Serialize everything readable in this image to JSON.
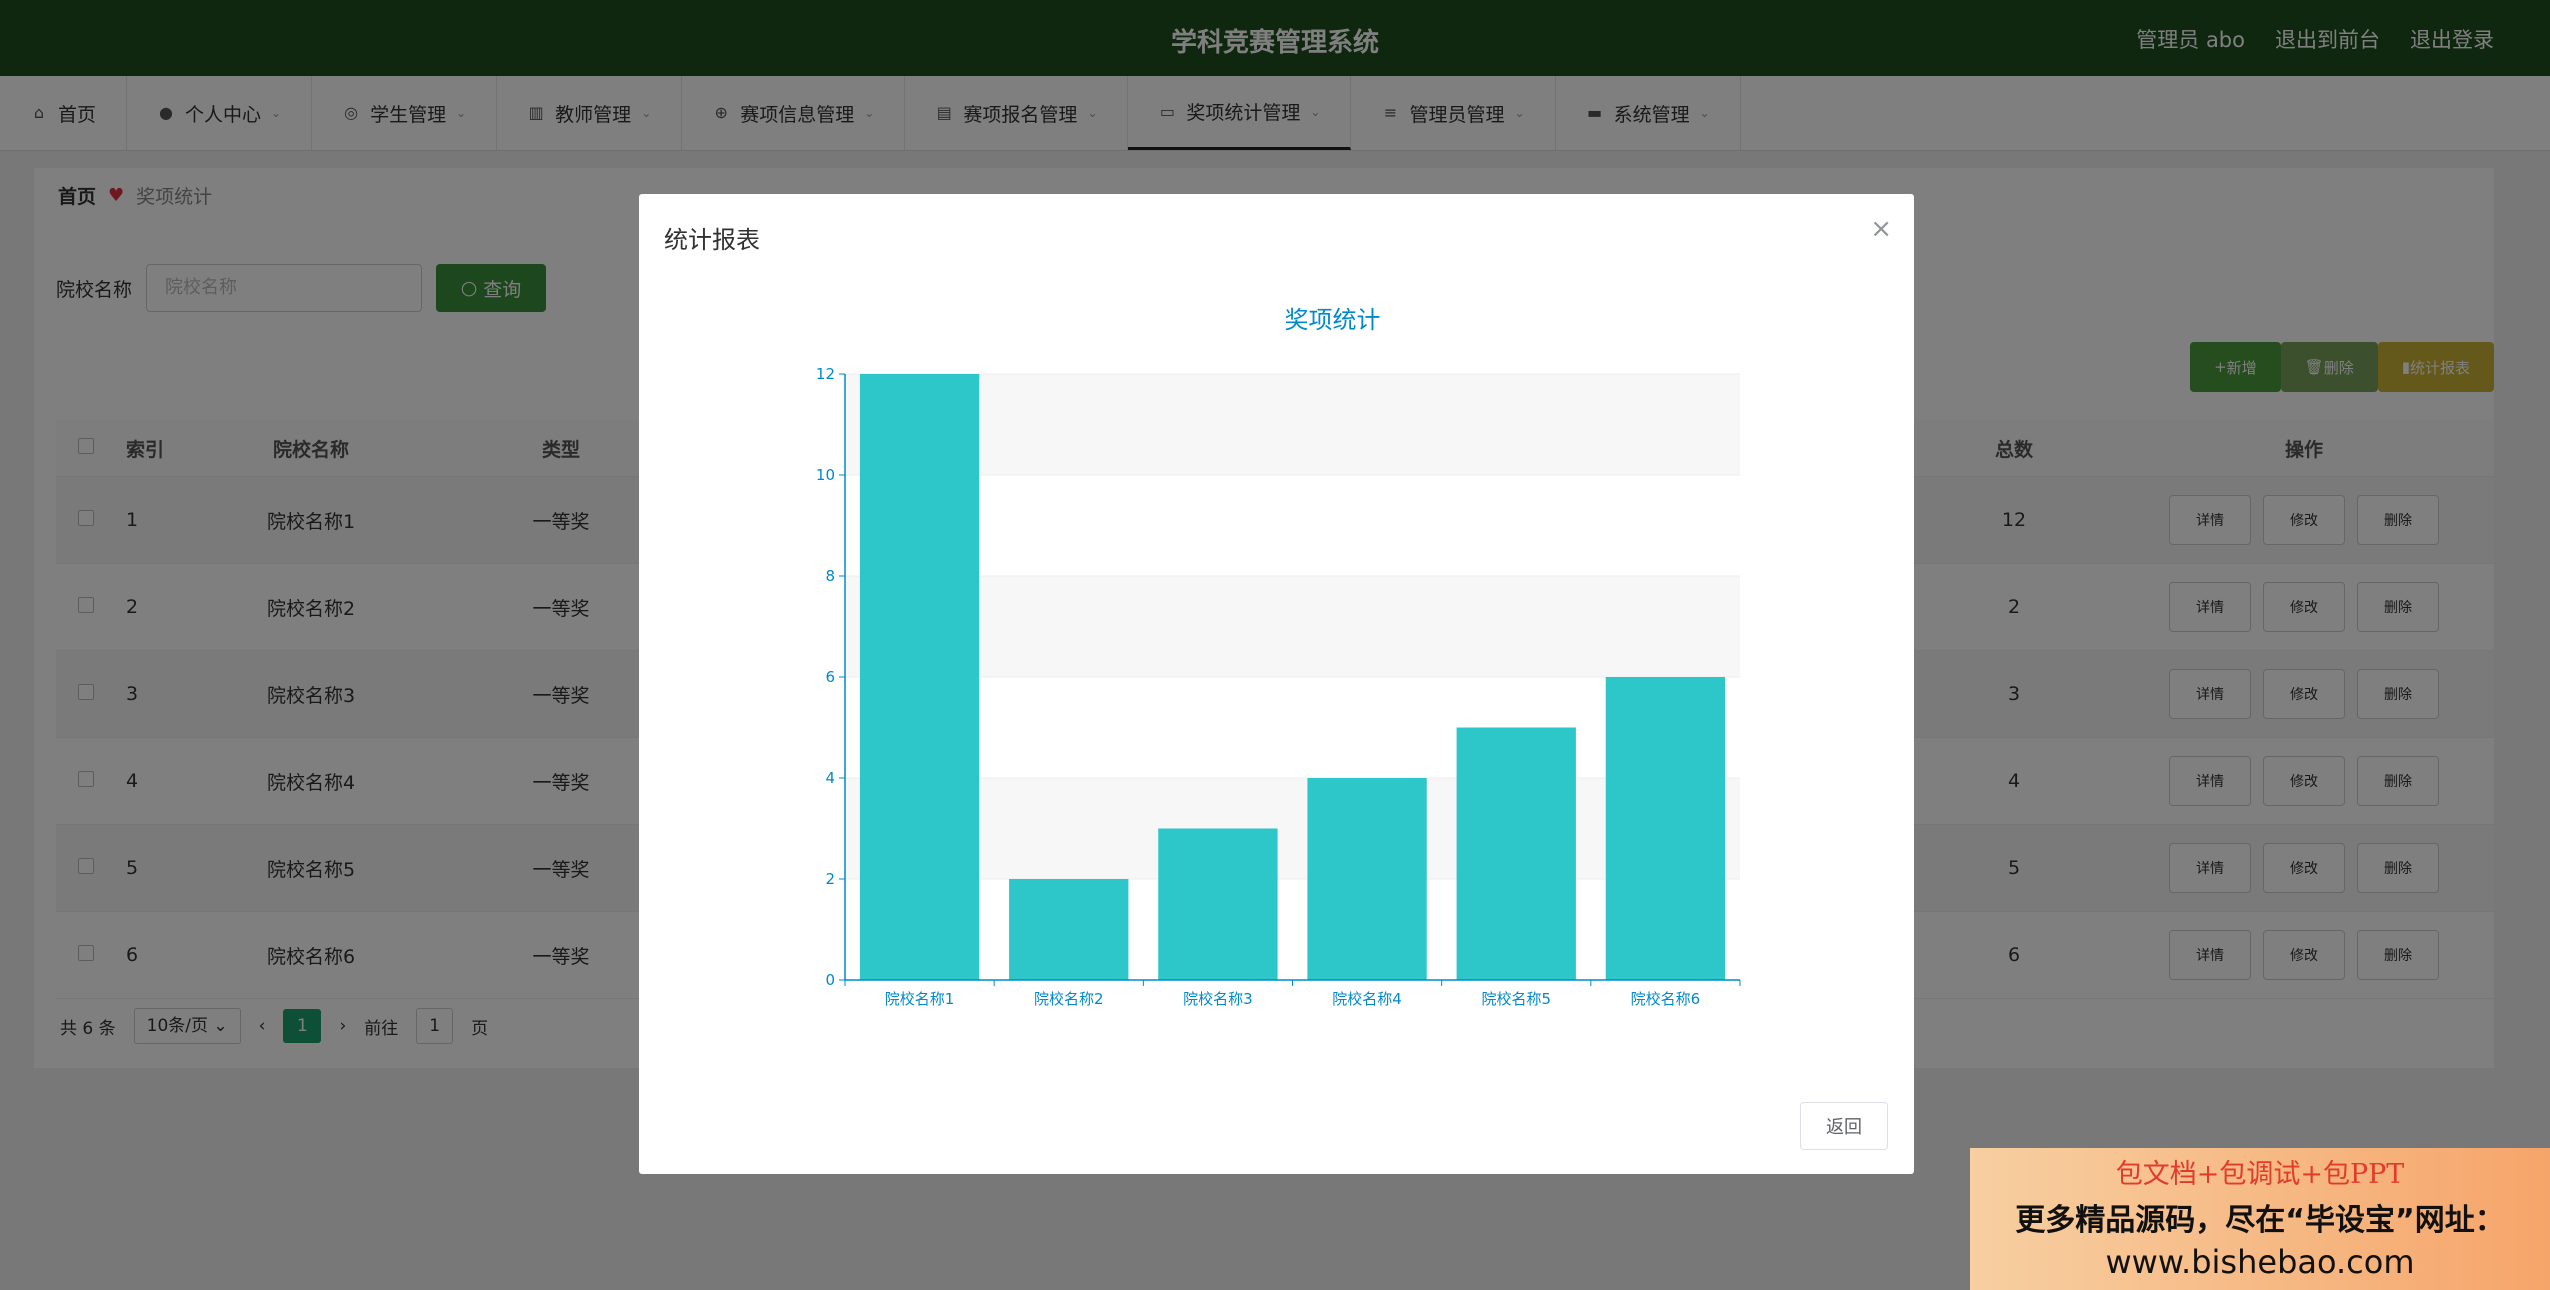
{
  "header": {
    "title": "学科竞赛管理系统",
    "user": "管理员 abo",
    "links": [
      "退出到前台",
      "退出登录"
    ]
  },
  "nav": [
    {
      "label": "首页",
      "icon": "home-icon"
    },
    {
      "label": "个人中心",
      "icon": "user-icon"
    },
    {
      "label": "学生管理",
      "icon": "compass-icon"
    },
    {
      "label": "教师管理",
      "icon": "bar-chart-icon"
    },
    {
      "label": "赛项信息管理",
      "icon": "target-icon"
    },
    {
      "label": "赛项报名管理",
      "icon": "clipboard-icon"
    },
    {
      "label": "奖项统计管理",
      "icon": "monitor-icon"
    },
    {
      "label": "管理员管理",
      "icon": "list-icon"
    },
    {
      "label": "系统管理",
      "icon": "chat-icon"
    }
  ],
  "breadcrumb": {
    "home": "首页",
    "current": "奖项统计"
  },
  "search": {
    "label": "院校名称",
    "placeholder": "院校名称",
    "button": "查询"
  },
  "toolbar": {
    "add": "新增",
    "delete": "删除",
    "report": "统计报表"
  },
  "table": {
    "headers": [
      "索引",
      "院校名称",
      "类型",
      "总数",
      "操作"
    ],
    "rows": [
      {
        "index": "1",
        "school": "院校名称1",
        "type": "一等奖",
        "total": "12"
      },
      {
        "index": "2",
        "school": "院校名称2",
        "type": "一等奖",
        "total": "2"
      },
      {
        "index": "3",
        "school": "院校名称3",
        "type": "一等奖",
        "total": "3"
      },
      {
        "index": "4",
        "school": "院校名称4",
        "type": "一等奖",
        "total": "4"
      },
      {
        "index": "5",
        "school": "院校名称5",
        "type": "一等奖",
        "total": "5"
      },
      {
        "index": "6",
        "school": "院校名称6",
        "type": "一等奖",
        "total": "6"
      }
    ],
    "row_actions": [
      "详情",
      "修改",
      "删除"
    ]
  },
  "pager": {
    "total": "共 6 条",
    "size": "10条/页",
    "page": "1",
    "goto": "前往",
    "goto_value": "1",
    "unit": "页"
  },
  "dialog": {
    "title": "统计报表",
    "back": "返回"
  },
  "chart_data": {
    "type": "bar",
    "title": "奖项统计",
    "categories": [
      "院校名称1",
      "院校名称2",
      "院校名称3",
      "院校名称4",
      "院校名称5",
      "院校名称6"
    ],
    "values": [
      12,
      2,
      3,
      4,
      5,
      6
    ],
    "ylim": [
      0,
      12
    ],
    "yticks": [
      0,
      2,
      4,
      6,
      8,
      10,
      12
    ],
    "bar_color": "#2ec7c9",
    "axis_color": "#008acd"
  },
  "watermark": {
    "line1": "包文档+包调试+包PPT",
    "line2": "更多精品源码，尽在“毕设宝”网址：",
    "line3": "www.bishebao.com"
  }
}
